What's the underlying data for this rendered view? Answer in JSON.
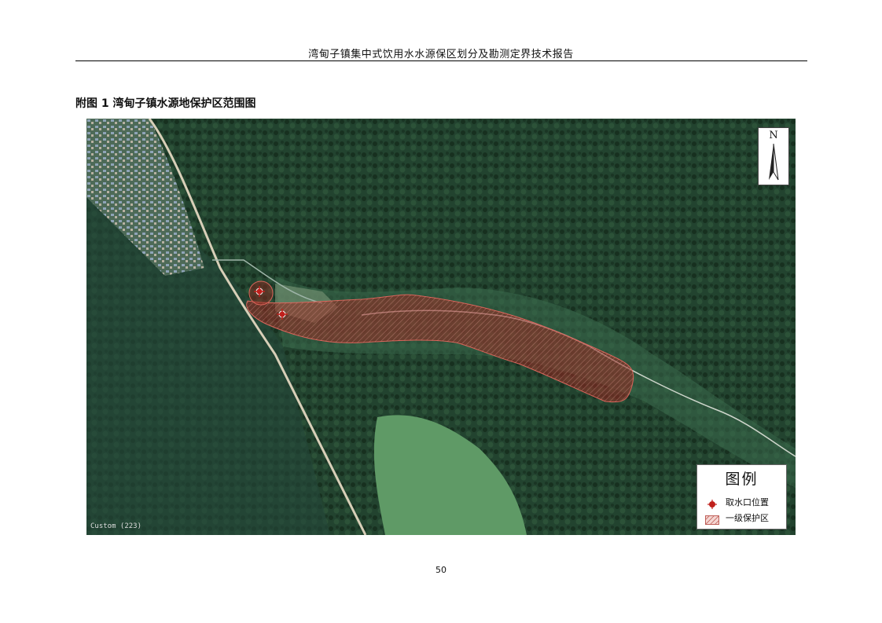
{
  "header": {
    "title": "湾甸子镇集中式饮用水水源保区划分及勘测定界技术报告"
  },
  "figure": {
    "caption": "附图 1  湾甸子镇水源地保护区范围图"
  },
  "map": {
    "north_label": "N",
    "scale_label": "Custom (223)",
    "legend": {
      "title": "图例",
      "items": [
        {
          "label": "取水口位置",
          "symbol": "intake-point-icon",
          "color": "#c0201c"
        },
        {
          "label": "一级保护区",
          "symbol": "hatched-zone-icon",
          "color": "#d07a72"
        }
      ]
    },
    "colors": {
      "forest": "#1f3f2e",
      "protection_zone": "#9a2a22",
      "road": "#d8cfb8",
      "meadow": "#5f9a66"
    }
  },
  "footer": {
    "page_number": "50"
  }
}
